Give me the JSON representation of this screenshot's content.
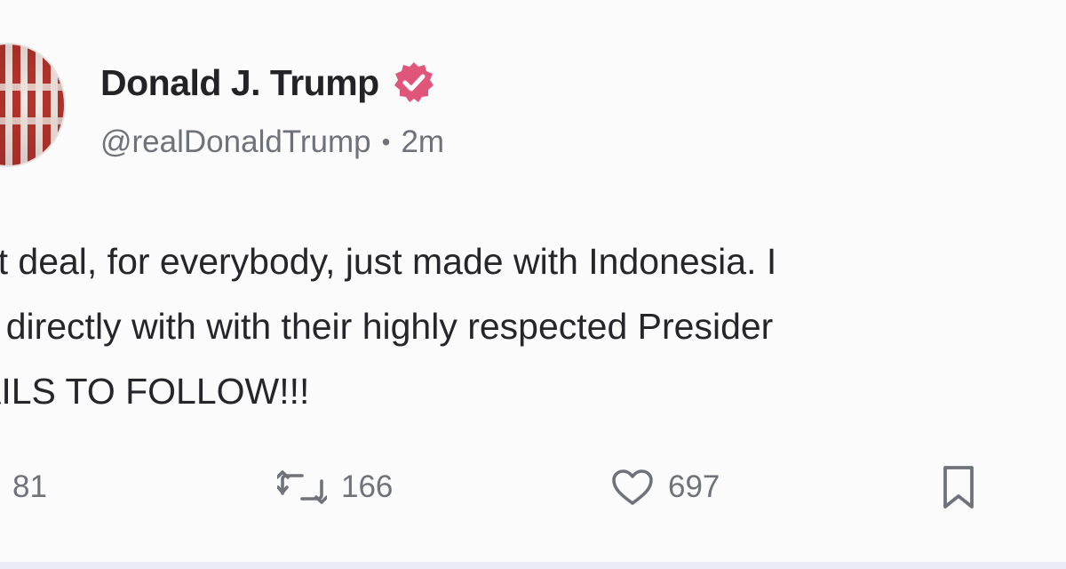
{
  "post": {
    "author": {
      "display_name": "Donald J. Trump",
      "handle": "@realDonaldTrump",
      "separator": "•",
      "time_ago": "2m",
      "verified_icon": "verified-badge-icon",
      "verified_color": "#e0567a"
    },
    "body_lines": [
      "eat deal, for everybody, just made with Indonesia. I",
      "alt directly with with their highly respected Presider",
      "TAILS TO FOLLOW!!!"
    ],
    "actions": {
      "replies": "81",
      "reposts": "166",
      "likes": "697",
      "reply_icon": "reply-icon",
      "repost_icon": "repost-icon",
      "like_icon": "heart-icon",
      "bookmark_icon": "bookmark-icon"
    }
  },
  "colors": {
    "background": "#fbfbfc",
    "text": "#26262a",
    "muted": "#6f727a",
    "bottom_strip": "#e9ebf5"
  }
}
